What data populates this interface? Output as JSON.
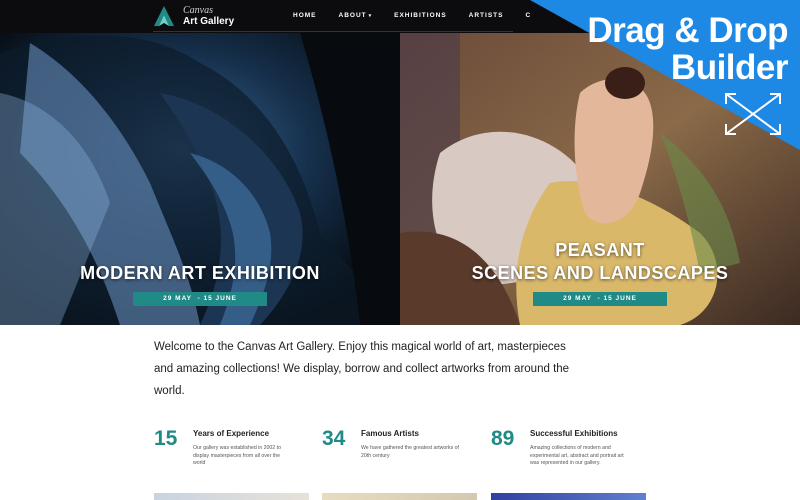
{
  "header": {
    "logo_small": "Canvas",
    "logo_big": "Art Gallery",
    "nav": [
      {
        "label": "HOME"
      },
      {
        "label": "ABOUT"
      },
      {
        "label": "EXHIBITIONS"
      },
      {
        "label": "ARTISTS"
      },
      {
        "label": "C"
      }
    ]
  },
  "hero": {
    "left": {
      "title": "MODERN ART EXHIBITION",
      "date": "29 MAY  - 15 JUNE"
    },
    "right": {
      "title_line1": "PEASANT",
      "title_line2": "SCENES AND LANDSCAPES",
      "date": "29 MAY  - 15 JUNE"
    }
  },
  "promo": {
    "line1": "Drag & Drop",
    "line2": "Builder"
  },
  "intro": {
    "text": "Welcome to the Canvas Art Gallery.  Enjoy this magical world of art, masterpieces and amazing collections! We display, borrow and collect artworks from around the world."
  },
  "stats": [
    {
      "number": "15",
      "title": "Years of Experience",
      "desc": "Our gallery was established in 2002 to display masterpieces from all over the world"
    },
    {
      "number": "34",
      "title": "Famous Artists",
      "desc": "We have gathered the greatest artworks of 20th century"
    },
    {
      "number": "89",
      "title": "Successful Exhibitions",
      "desc": "Amazing collections of modern and experimental art, abstract and portrait art was represented in our gallery."
    }
  ],
  "colors": {
    "accent": "#1f8a86",
    "promo": "#1e88e5",
    "header": "#0c0c0e"
  },
  "icons": {
    "logo": "triangle-a-logo-icon",
    "promo": "move-arrows-icon"
  }
}
